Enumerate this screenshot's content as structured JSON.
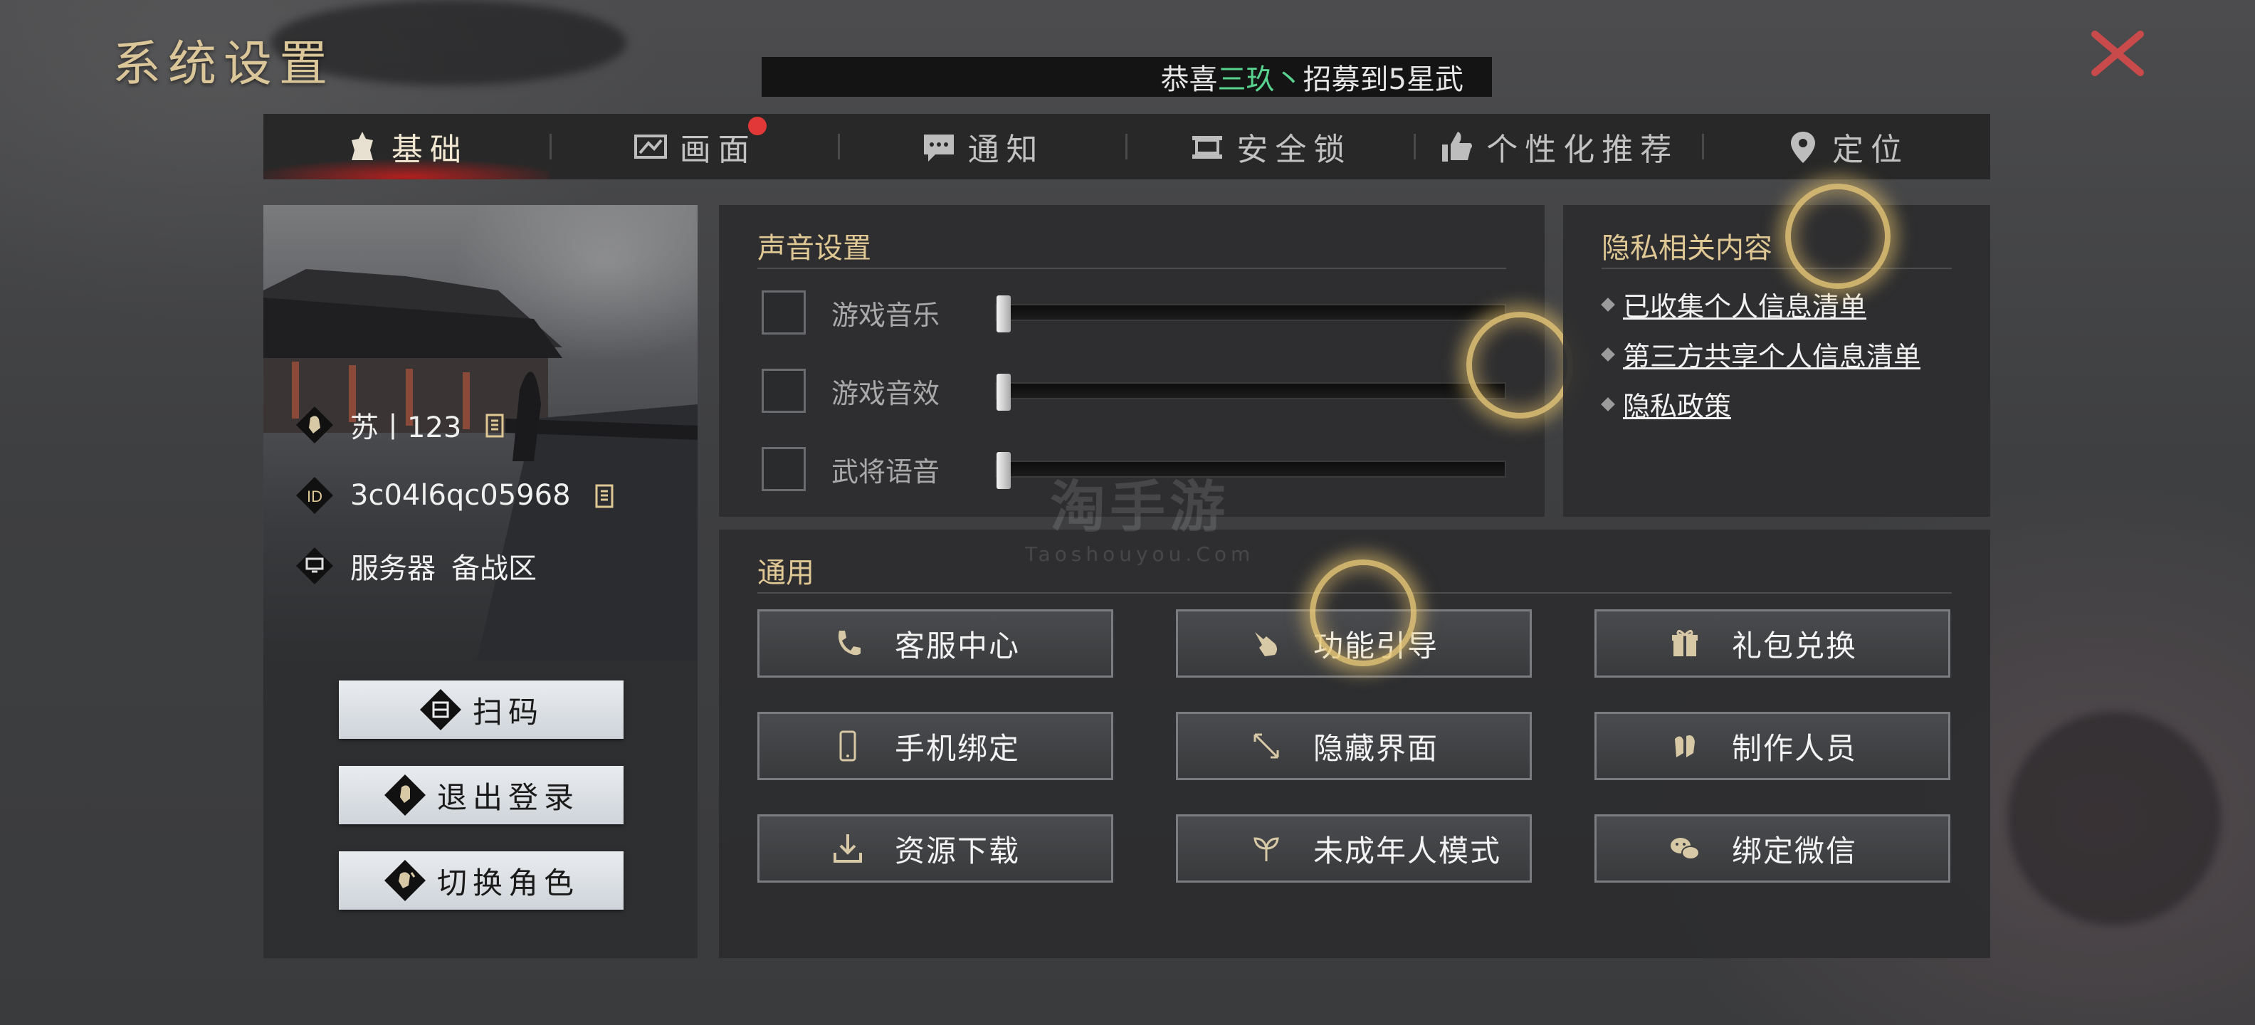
{
  "header": {
    "title": "系统设置",
    "marquee_prefix": "恭喜",
    "marquee_name": "三玖丶",
    "marquee_suffix": "招募到5星武"
  },
  "tabs": [
    {
      "label": "基础",
      "icon": "helmet-icon",
      "active": true
    },
    {
      "label": "画面",
      "icon": "display-icon",
      "badge": true
    },
    {
      "label": "通知",
      "icon": "chat-bubble-icon"
    },
    {
      "label": "安全锁",
      "icon": "lock-bar-icon"
    },
    {
      "label": "个性化推荐",
      "icon": "thumbs-up-icon"
    },
    {
      "label": "定位",
      "icon": "location-pin-icon"
    }
  ],
  "profile": {
    "name": "苏丨123",
    "id_label": "ID",
    "id_value": "3c04l6qc05968",
    "server_label": "服务器",
    "server_value": "备战区",
    "buttons": {
      "scan": "扫码",
      "logout": "退出登录",
      "switch_role": "切换角色"
    }
  },
  "sound": {
    "title": "声音设置",
    "rows": [
      {
        "label": "游戏音乐",
        "checked": false,
        "level": 0.0
      },
      {
        "label": "游戏音效",
        "checked": false,
        "level": 0.0
      },
      {
        "label": "武将语音",
        "checked": false,
        "level": 0.0
      }
    ]
  },
  "privacy": {
    "title": "隐私相关内容",
    "links": [
      "已收集个人信息清单",
      "第三方共享个人信息清单",
      "隐私政策"
    ]
  },
  "general": {
    "title": "通用",
    "buttons": [
      {
        "label": "客服中心",
        "icon": "phone-handset-icon"
      },
      {
        "label": "功能引导",
        "icon": "pointing-hand-icon"
      },
      {
        "label": "礼包兑换",
        "icon": "gift-icon"
      },
      {
        "label": "手机绑定",
        "icon": "mobile-phone-icon"
      },
      {
        "label": "隐藏界面",
        "icon": "resize-arrows-icon"
      },
      {
        "label": "制作人员",
        "icon": "team-icon"
      },
      {
        "label": "资源下载",
        "icon": "download-icon"
      },
      {
        "label": "未成年人模式",
        "icon": "sprout-icon"
      },
      {
        "label": "绑定微信",
        "icon": "wechat-icon"
      }
    ]
  },
  "watermark": {
    "line1": "淘手游",
    "line2": "Taoshouyou.Com"
  },
  "colors": {
    "accent_gold": "#e0c895",
    "close_red": "#c94a4a",
    "highlight_green": "#58d28e",
    "badge_red": "#e33838"
  }
}
